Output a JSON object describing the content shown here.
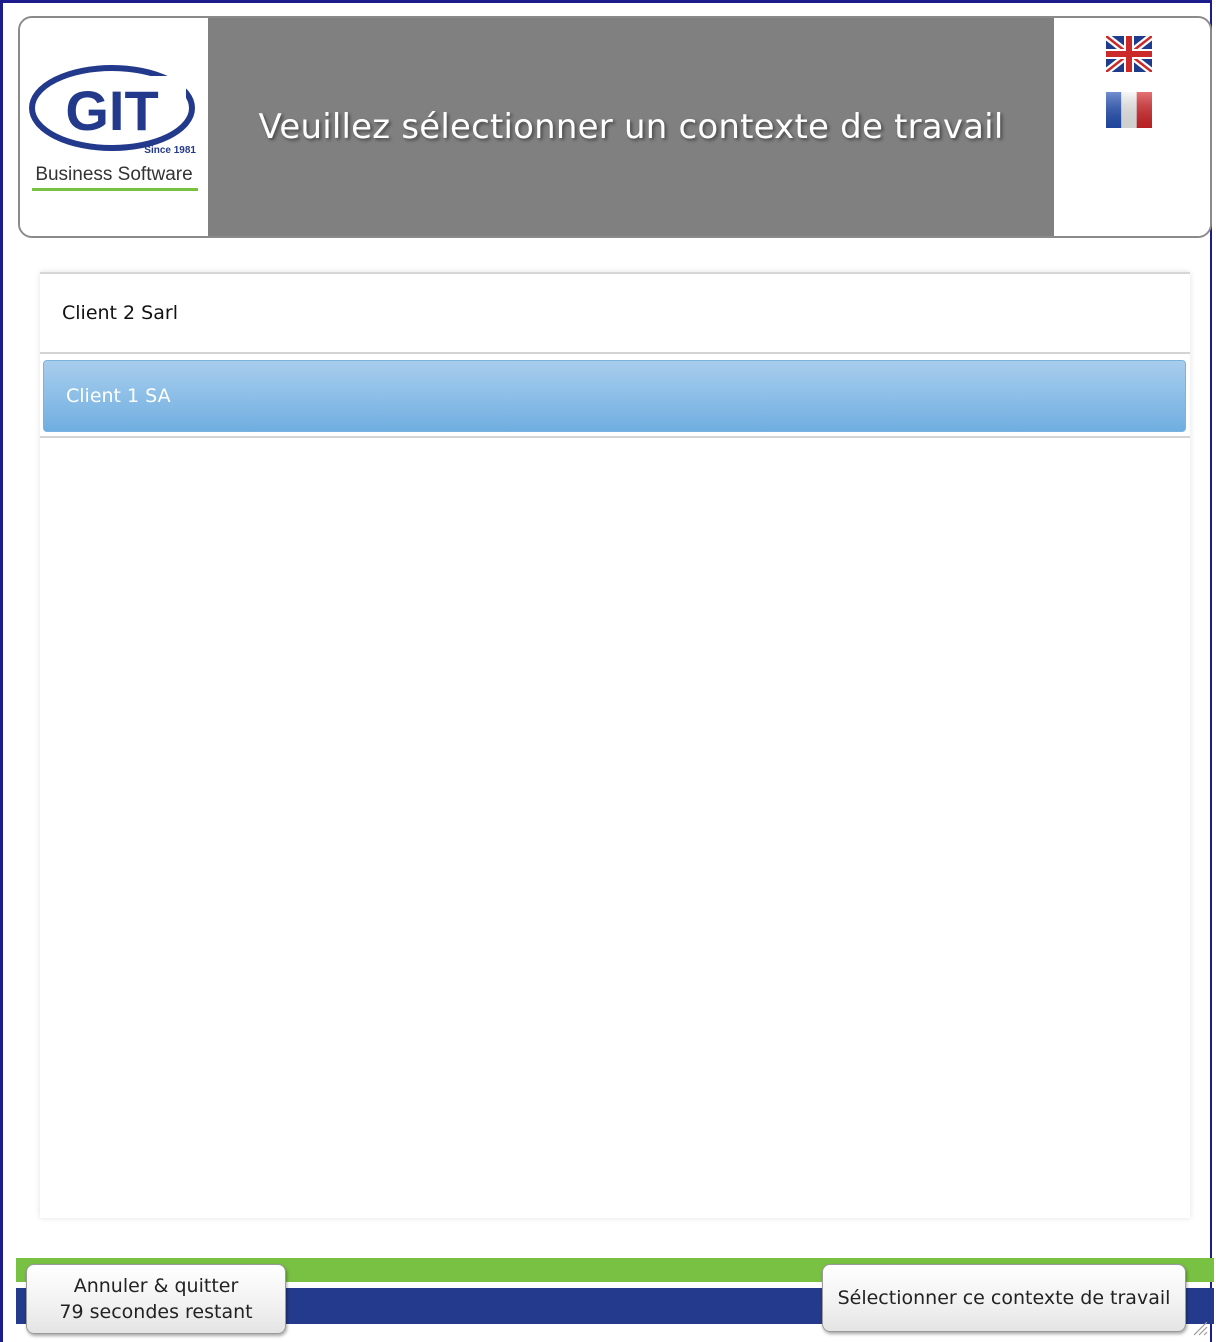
{
  "header": {
    "logo_text": "GIT",
    "logo_since": "Since 1981",
    "logo_tagline": "Business Software",
    "title": "Veuillez sélectionner un contexte de travail",
    "languages": [
      {
        "name": "english-flag",
        "icon": "uk-flag-icon"
      },
      {
        "name": "french-flag",
        "icon": "fr-flag-icon"
      }
    ]
  },
  "contexts": {
    "items": [
      {
        "label": "Client 2 Sarl",
        "selected": false
      },
      {
        "label": "Client 1 SA",
        "selected": true
      }
    ]
  },
  "footer": {
    "cancel_line1": "Annuler & quitter",
    "cancel_line2": "79 secondes restant",
    "select_label": "Sélectionner ce contexte de travail"
  },
  "colors": {
    "title_band": "#808080",
    "selection": "#8fc0e8",
    "footer_green": "#79c143",
    "footer_blue": "#243a8c",
    "logo_blue": "#233a8c"
  }
}
